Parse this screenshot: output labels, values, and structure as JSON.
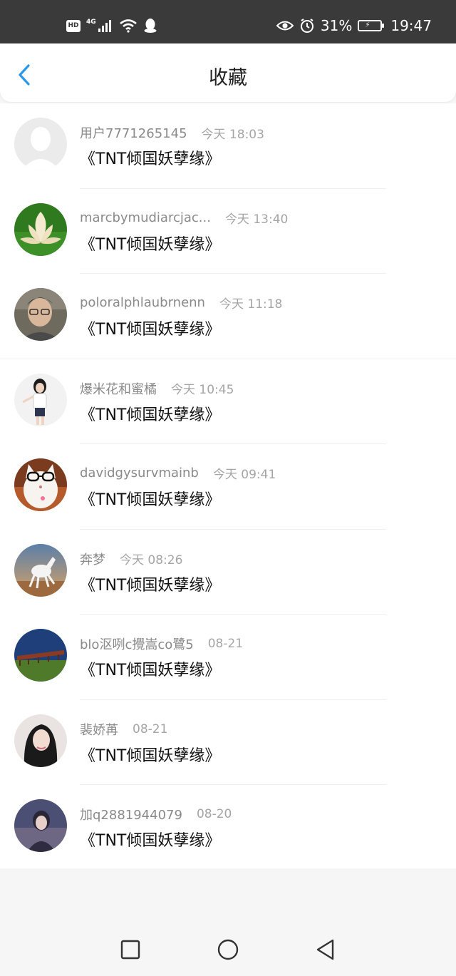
{
  "status_bar": {
    "left_icons": [
      "hd-icon",
      "4g-signal-icon",
      "wifi-icon",
      "qq-icon"
    ],
    "hd_label": "HD",
    "network_label": "4G",
    "right_icons": [
      "eye-icon",
      "alarm-icon",
      "battery-icon"
    ],
    "battery_percent": "31%",
    "time": "19:47"
  },
  "nav": {
    "title": "收藏",
    "back_icon": "chevron-left-icon",
    "accent_color": "#2a97e8"
  },
  "list": {
    "items": [
      {
        "user": "用户7771265145",
        "time": "今天 18:03",
        "title": "《TNT倾国妖孽缘》",
        "avatar": "default-avatar"
      },
      {
        "user": "marcbymudiarcjac...",
        "time": "今天 13:40",
        "title": "《TNT倾国妖孽缘》",
        "avatar": "lotus-avatar"
      },
      {
        "user": "poloralphlaubrnenn",
        "time": "今天 11:18",
        "title": "《TNT倾国妖孽缘》",
        "avatar": "man-glasses-avatar"
      },
      {
        "user": "爆米花和蜜橘",
        "time": "今天 10:45",
        "title": "《TNT倾国妖孽缘》",
        "avatar": "girl-avatar"
      },
      {
        "user": "davidgysurvmainb",
        "time": "今天 09:41",
        "title": "《TNT倾国妖孽缘》",
        "avatar": "cat-glasses-avatar"
      },
      {
        "user": "奔梦",
        "time": "今天 08:26",
        "title": "《TNT倾国妖孽缘》",
        "avatar": "white-horse-avatar"
      },
      {
        "user": "blo沤咧c攪嵩co鷺5",
        "time": "08-21",
        "title": "《TNT倾国妖孽缘》",
        "avatar": "bridge-avatar"
      },
      {
        "user": "裴娇苒",
        "time": "08-21",
        "title": "《TNT倾国妖孽缘》",
        "avatar": "woman-portrait-avatar"
      },
      {
        "user": "加q2881944079",
        "time": "08-20",
        "title": "《TNT倾国妖孽缘》",
        "avatar": "night-girl-avatar"
      }
    ]
  },
  "bottom_nav": {
    "icons": [
      "recent-apps-icon",
      "home-icon",
      "back-triangle-icon"
    ]
  }
}
